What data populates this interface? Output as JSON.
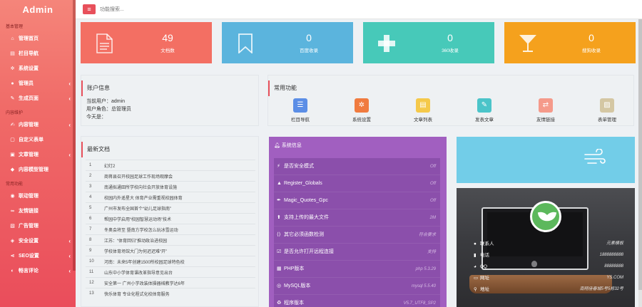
{
  "brand": "Admin",
  "sidebar": {
    "sections": [
      {
        "label": "基本管理",
        "items": [
          {
            "label": "管理首页",
            "icon": "home-icon",
            "glyph": "⌂",
            "chevron": false
          },
          {
            "label": "栏目导航",
            "icon": "sitemap-icon",
            "glyph": "▤",
            "chevron": false
          },
          {
            "label": "系统设置",
            "icon": "gear-icon",
            "glyph": "✲",
            "chevron": false
          },
          {
            "label": "管理员",
            "icon": "user-icon",
            "glyph": "●",
            "chevron": true
          },
          {
            "label": "生成页面",
            "icon": "pencil-icon",
            "glyph": "✎",
            "chevron": true
          }
        ]
      },
      {
        "label": "内容维护",
        "items": [
          {
            "label": "内容管理",
            "icon": "edit-icon",
            "glyph": "✍",
            "chevron": true
          },
          {
            "label": "自定义表单",
            "icon": "file-icon",
            "glyph": "▢",
            "chevron": false
          },
          {
            "label": "文章管理",
            "icon": "book-icon",
            "glyph": "▣",
            "chevron": true
          },
          {
            "label": "内容模型管理",
            "icon": "tag-icon",
            "glyph": "◆",
            "chevron": false
          }
        ]
      },
      {
        "label": "常用功能",
        "items": [
          {
            "label": "联动管理",
            "icon": "map-pin-icon",
            "glyph": "◉",
            "chevron": false
          },
          {
            "label": "友情链接",
            "icon": "link-icon",
            "glyph": "∞",
            "chevron": false
          },
          {
            "label": "广告管理",
            "icon": "image-icon",
            "glyph": "▧",
            "chevron": false
          },
          {
            "label": "安全设置",
            "icon": "shield-icon",
            "glyph": "◈",
            "chevron": true
          },
          {
            "label": "SEO设置",
            "icon": "share-icon",
            "glyph": "⋖",
            "chevron": true
          },
          {
            "label": "畅言评论",
            "icon": "comment-icon",
            "glyph": "◐",
            "chevron": true
          }
        ]
      }
    ]
  },
  "topbar": {
    "menu_icon": "≡",
    "search_placeholder": "功能搜索..."
  },
  "stats": [
    {
      "value": "49",
      "label": "文档数",
      "color": "#f36f63",
      "icon": "document-icon"
    },
    {
      "value": "0",
      "label": "百度收录",
      "color": "#5bb4dd",
      "icon": "bookmark-icon"
    },
    {
      "value": "0",
      "label": "360收录",
      "color": "#47c9b9",
      "icon": "plus-icon"
    },
    {
      "value": "0",
      "label": "搜狗收录",
      "color": "#f5a11d",
      "icon": "cocktail-icon"
    }
  ],
  "account": {
    "title": "账户信息",
    "current_user": "当前用户：admin",
    "user_role": "用户角色：总管理员",
    "today": "今天是："
  },
  "functions": {
    "title": "常用功能",
    "items": [
      {
        "label": "栏目导航",
        "color": "#5b8ee6",
        "glyph": "☰",
        "icon": "list-icon"
      },
      {
        "label": "系统设置",
        "color": "#f07b3f",
        "glyph": "✲",
        "icon": "gear-icon"
      },
      {
        "label": "文章列表",
        "color": "#f5c94a",
        "glyph": "▤",
        "icon": "article-icon"
      },
      {
        "label": "发表文章",
        "color": "#4bc4c9",
        "glyph": "✎",
        "icon": "brush-icon"
      },
      {
        "label": "友情链接",
        "color": "#f59a8a",
        "glyph": "⇄",
        "icon": "link-icon"
      },
      {
        "label": "表单管理",
        "color": "#d4c7a3",
        "glyph": "▨",
        "icon": "form-icon"
      }
    ]
  },
  "docs": {
    "title": "最新文档",
    "rows": [
      {
        "no": "1",
        "title": "幻灯2"
      },
      {
        "no": "2",
        "title": "商蒋县召开校园足球工作现场观摩会"
      },
      {
        "no": "3",
        "title": "南通拟通田所学校向社会开放体育设施"
      },
      {
        "no": "4",
        "title": "校园内外遥星大 体育产业需重视校园体育"
      },
      {
        "no": "5",
        "title": "广州市发布全国首个“幼儿足球指南”"
      },
      {
        "no": "6",
        "title": "帮园中学启用“校园智慧运动场”技术"
      },
      {
        "no": "7",
        "title": "冬奥会将至 暨南方学校怎么玩冰雪运动"
      },
      {
        "no": "8",
        "title": "江苏：“体育回归”推动政治进校园"
      },
      {
        "no": "9",
        "title": "学校体育场馆大门为何迟迟难“开”"
      },
      {
        "no": "10",
        "title": "河南：未来5年创建1500所校园足球特色校"
      },
      {
        "no": "11",
        "title": "山东中小学体育课改革指导意见出台"
      },
      {
        "no": "12",
        "title": "安全第一 广州小学改装体操器械教学达6年"
      },
      {
        "no": "13",
        "title": "快乐体育 专业化程式化校体育服务"
      }
    ]
  },
  "sysinfo": {
    "title": "系统信息",
    "rows": [
      {
        "label": "是否安全模式",
        "value": "Off",
        "glyph": "⚡",
        "icon": "bolt-icon"
      },
      {
        "label": "Register_Globals",
        "value": "Off",
        "glyph": "▲",
        "icon": "flask-icon"
      },
      {
        "label": "Magic_Quotes_Gpc",
        "value": "Off",
        "glyph": "✒",
        "icon": "magic-icon"
      },
      {
        "label": "支持上传的最大文件",
        "value": "2M",
        "glyph": "⬆",
        "icon": "upload-icon"
      },
      {
        "label": "其它必须函数检测",
        "value": "符合要求",
        "glyph": "⟨⟩",
        "icon": "code-icon"
      },
      {
        "label": "是否允许打开远程连接",
        "value": "支持",
        "glyph": "☑",
        "icon": "check-icon"
      },
      {
        "label": "PHP版本",
        "value": "php 5.3.29",
        "glyph": "▦",
        "icon": "php-icon"
      },
      {
        "label": "MySQL版本",
        "value": "mysql 5.5.40",
        "glyph": "◎",
        "icon": "database-icon"
      },
      {
        "label": "程序版本",
        "value": "V5.7_UTF8_SP2",
        "glyph": "♻",
        "icon": "program-icon"
      }
    ]
  },
  "contact": {
    "rows": [
      {
        "label": "联系人",
        "value": "元素模板",
        "glyph": "●",
        "icon": "person-icon"
      },
      {
        "label": "电话",
        "value": "1888888888",
        "glyph": "▮",
        "icon": "phone-icon"
      },
      {
        "label": "QQ",
        "value": "88888888",
        "glyph": "◕",
        "icon": "qq-icon"
      },
      {
        "label": "网址",
        "value": "YS.COM",
        "glyph": "▭",
        "icon": "website-icon"
      },
      {
        "label": "地址",
        "value": "南翔佳春城5号5栋32号",
        "glyph": "⚲",
        "icon": "location-icon"
      }
    ]
  }
}
